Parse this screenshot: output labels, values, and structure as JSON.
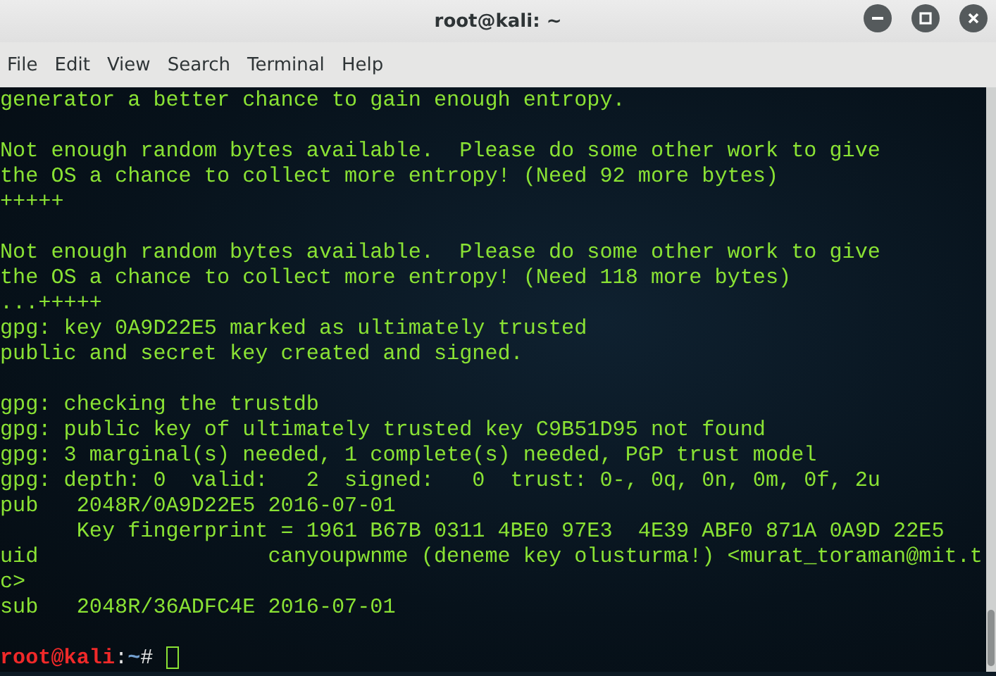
{
  "window": {
    "title": "root@kali: ~"
  },
  "menu": [
    "File",
    "Edit",
    "View",
    "Search",
    "Terminal",
    "Help"
  ],
  "terminal": {
    "lines": [
      {
        "kind": "text",
        "text": "generator a better chance to gain enough entropy."
      },
      {
        "kind": "blank"
      },
      {
        "kind": "text",
        "text": "Not enough random bytes available.  Please do some other work to give"
      },
      {
        "kind": "text",
        "text": "the OS a chance to collect more entropy! (Need 92 more bytes)"
      },
      {
        "kind": "text",
        "text": "+++++"
      },
      {
        "kind": "blank"
      },
      {
        "kind": "text",
        "text": "Not enough random bytes available.  Please do some other work to give"
      },
      {
        "kind": "text",
        "text": "the OS a chance to collect more entropy! (Need 118 more bytes)"
      },
      {
        "kind": "text",
        "text": "...+++++"
      },
      {
        "kind": "text",
        "text": "gpg: key 0A9D22E5 marked as ultimately trusted"
      },
      {
        "kind": "text",
        "text": "public and secret key created and signed."
      },
      {
        "kind": "blank"
      },
      {
        "kind": "text",
        "text": "gpg: checking the trustdb"
      },
      {
        "kind": "text",
        "text": "gpg: public key of ultimately trusted key C9B51D95 not found"
      },
      {
        "kind": "text",
        "text": "gpg: 3 marginal(s) needed, 1 complete(s) needed, PGP trust model"
      },
      {
        "kind": "text",
        "text": "gpg: depth: 0  valid:   2  signed:   0  trust: 0-, 0q, 0n, 0m, 0f, 2u"
      },
      {
        "kind": "text",
        "text": "pub   2048R/0A9D22E5 2016-07-01"
      },
      {
        "kind": "text",
        "text": "      Key fingerprint = 1961 B67B 0311 4BE0 97E3  4E39 ABF0 871A 0A9D 22E5"
      },
      {
        "kind": "text",
        "text": "uid                  canyoupwnme (deneme key olusturma!) <murat_toraman@mit.t"
      },
      {
        "kind": "text",
        "text": "c>"
      },
      {
        "kind": "text",
        "text": "sub   2048R/36ADFC4E 2016-07-01"
      },
      {
        "kind": "blank"
      }
    ],
    "prompt": {
      "user": "root@kali",
      "separator": ":",
      "path": "~",
      "symbol": "#"
    }
  }
}
